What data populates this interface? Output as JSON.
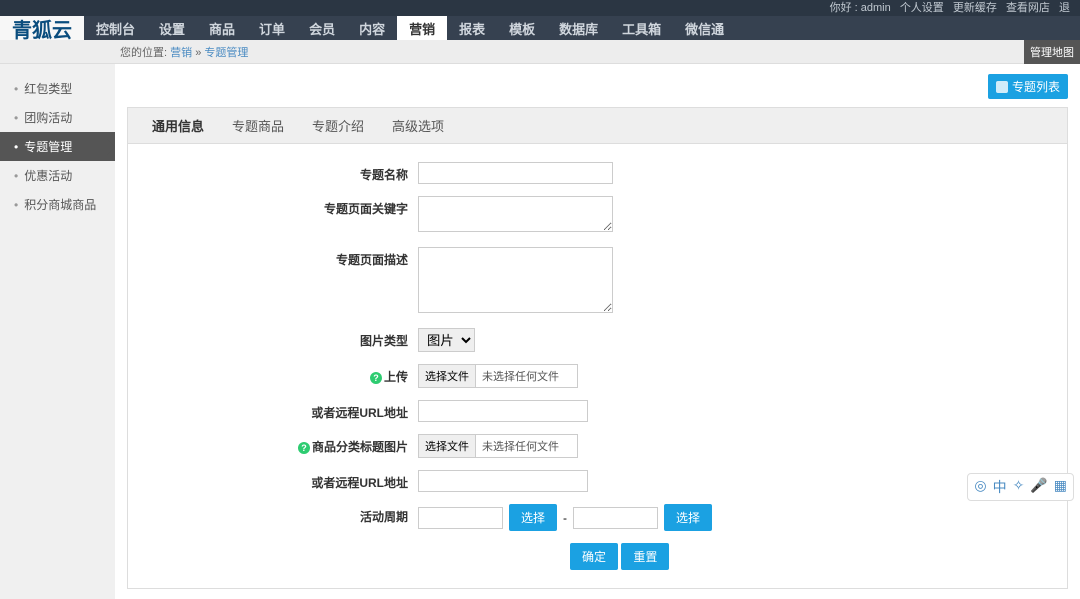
{
  "topbar": {
    "greeting": "你好 : admin",
    "links": [
      "个人设置",
      "更新缓存",
      "查看网店",
      "退"
    ]
  },
  "brand": "青狐云",
  "nav": [
    {
      "label": "控制台",
      "active": false
    },
    {
      "label": "设置",
      "active": false
    },
    {
      "label": "商品",
      "active": false
    },
    {
      "label": "订单",
      "active": false
    },
    {
      "label": "会员",
      "active": false
    },
    {
      "label": "内容",
      "active": false
    },
    {
      "label": "营销",
      "active": true
    },
    {
      "label": "报表",
      "active": false
    },
    {
      "label": "模板",
      "active": false
    },
    {
      "label": "数据库",
      "active": false
    },
    {
      "label": "工具箱",
      "active": false
    },
    {
      "label": "微信通",
      "active": false
    }
  ],
  "breadcrumb": {
    "prefix": "您的位置:",
    "path": [
      "营销",
      "专题管理"
    ],
    "sep": " » ",
    "right": "管理地图"
  },
  "sidebar": [
    {
      "label": "红包类型",
      "active": false
    },
    {
      "label": "团购活动",
      "active": false
    },
    {
      "label": "专题管理",
      "active": true
    },
    {
      "label": "优惠活动",
      "active": false
    },
    {
      "label": "积分商城商品",
      "active": false
    }
  ],
  "actions": {
    "list_button": "专题列表"
  },
  "tabs": [
    {
      "label": "通用信息",
      "active": true
    },
    {
      "label": "专题商品",
      "active": false
    },
    {
      "label": "专题介绍",
      "active": false
    },
    {
      "label": "高级选项",
      "active": false
    }
  ],
  "form": {
    "name_label": "专题名称",
    "keywords_label": "专题页面关键字",
    "desc_label": "专题页面描述",
    "imgtype_label": "图片类型",
    "imgtype_value": "图片",
    "upload_label": "上传",
    "file_button": "选择文件",
    "file_none": "未选择任何文件",
    "remote_url_label": "或者远程URL地址",
    "category_img_label": "商品分类标题图片",
    "remote_url_label2": "或者远程URL地址",
    "period_label": "活动周期",
    "select_btn": "选择",
    "dash": "-",
    "submit": "确定",
    "reset": "重置"
  }
}
